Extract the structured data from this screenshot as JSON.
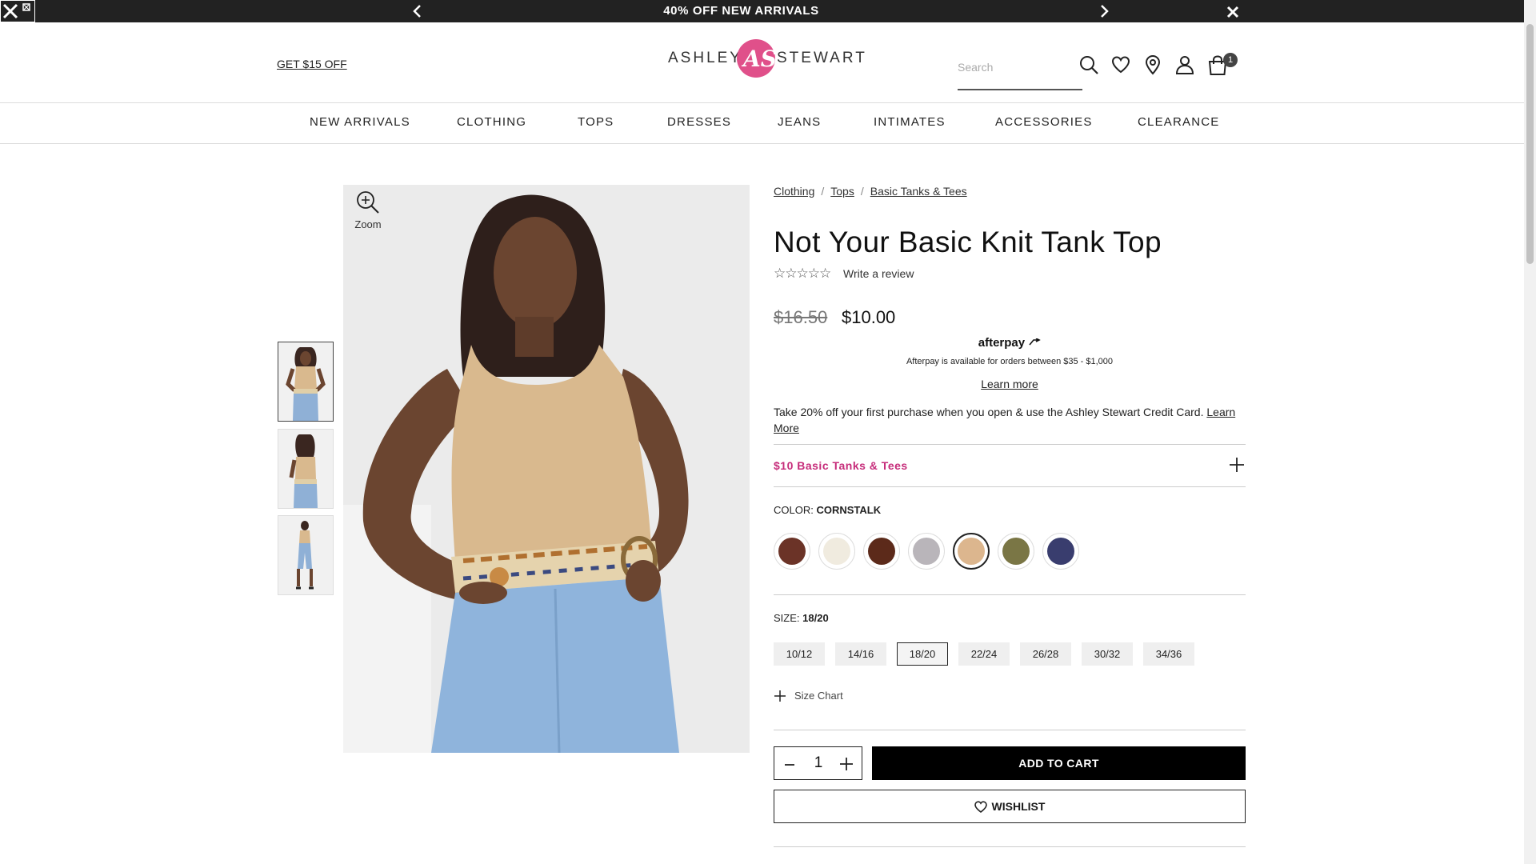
{
  "promo_bar": {
    "message": "40% OFF NEW ARRIVALS",
    "prev_icon": "chevron-left-icon",
    "next_icon": "chevron-right-icon",
    "close_icon": "close-icon"
  },
  "header": {
    "get_off_link": "GET $15 OFF",
    "logo": {
      "word_left": "ASHLEY",
      "word_right": "STEWART",
      "monogram": "AS",
      "brand_color": "#e0508a"
    },
    "search_placeholder": "Search",
    "cart_count": "1"
  },
  "nav": {
    "items": [
      "NEW ARRIVALS",
      "CLOTHING",
      "TOPS",
      "DRESSES",
      "JEANS",
      "INTIMATES",
      "ACCESSORIES",
      "CLEARANCE"
    ]
  },
  "gallery": {
    "zoom_label": "Zoom",
    "thumbnail_count": 3,
    "active_thumbnail": 1
  },
  "product": {
    "breadcrumbs": [
      "Clothing",
      "Tops",
      "Basic Tanks & Tees"
    ],
    "breadcrumb_separator": "/",
    "title": "Not Your Basic Knit Tank Top",
    "rating_stars": "☆☆☆☆☆",
    "rating_value": 0,
    "write_review": "Write a review",
    "original_price": "$16.50",
    "sale_price": "$10.00",
    "afterpay": {
      "logo": "afterpay",
      "note": "Afterpay is available for orders between $35 - $1,000",
      "learn_more": "Learn more"
    },
    "credit_text": "Take 20% off your first purchase when you open & use the Ashley Stewart Credit Card.",
    "credit_link": "Learn More",
    "promo_label": "$10 Basic Tanks & Tees",
    "promo_color": "#c62c7a",
    "color_label": "COLOR:",
    "color_value": "CORNSTALK",
    "swatches": [
      "#6b3327",
      "#f0ebdf",
      "#5c2a1a",
      "#b9b5ba",
      "#dcb68e",
      "#7a7645",
      "#393d6e"
    ],
    "selected_swatch": 4,
    "size_label": "SIZE:",
    "size_value": "18/20",
    "sizes": [
      "10/12",
      "14/16",
      "18/20",
      "22/24",
      "26/28",
      "30/32",
      "34/36"
    ],
    "selected_size": 2,
    "size_chart": "Size Chart",
    "quantity": "1",
    "add_to_cart": "ADD TO CART",
    "wishlist": "WISHLIST"
  }
}
